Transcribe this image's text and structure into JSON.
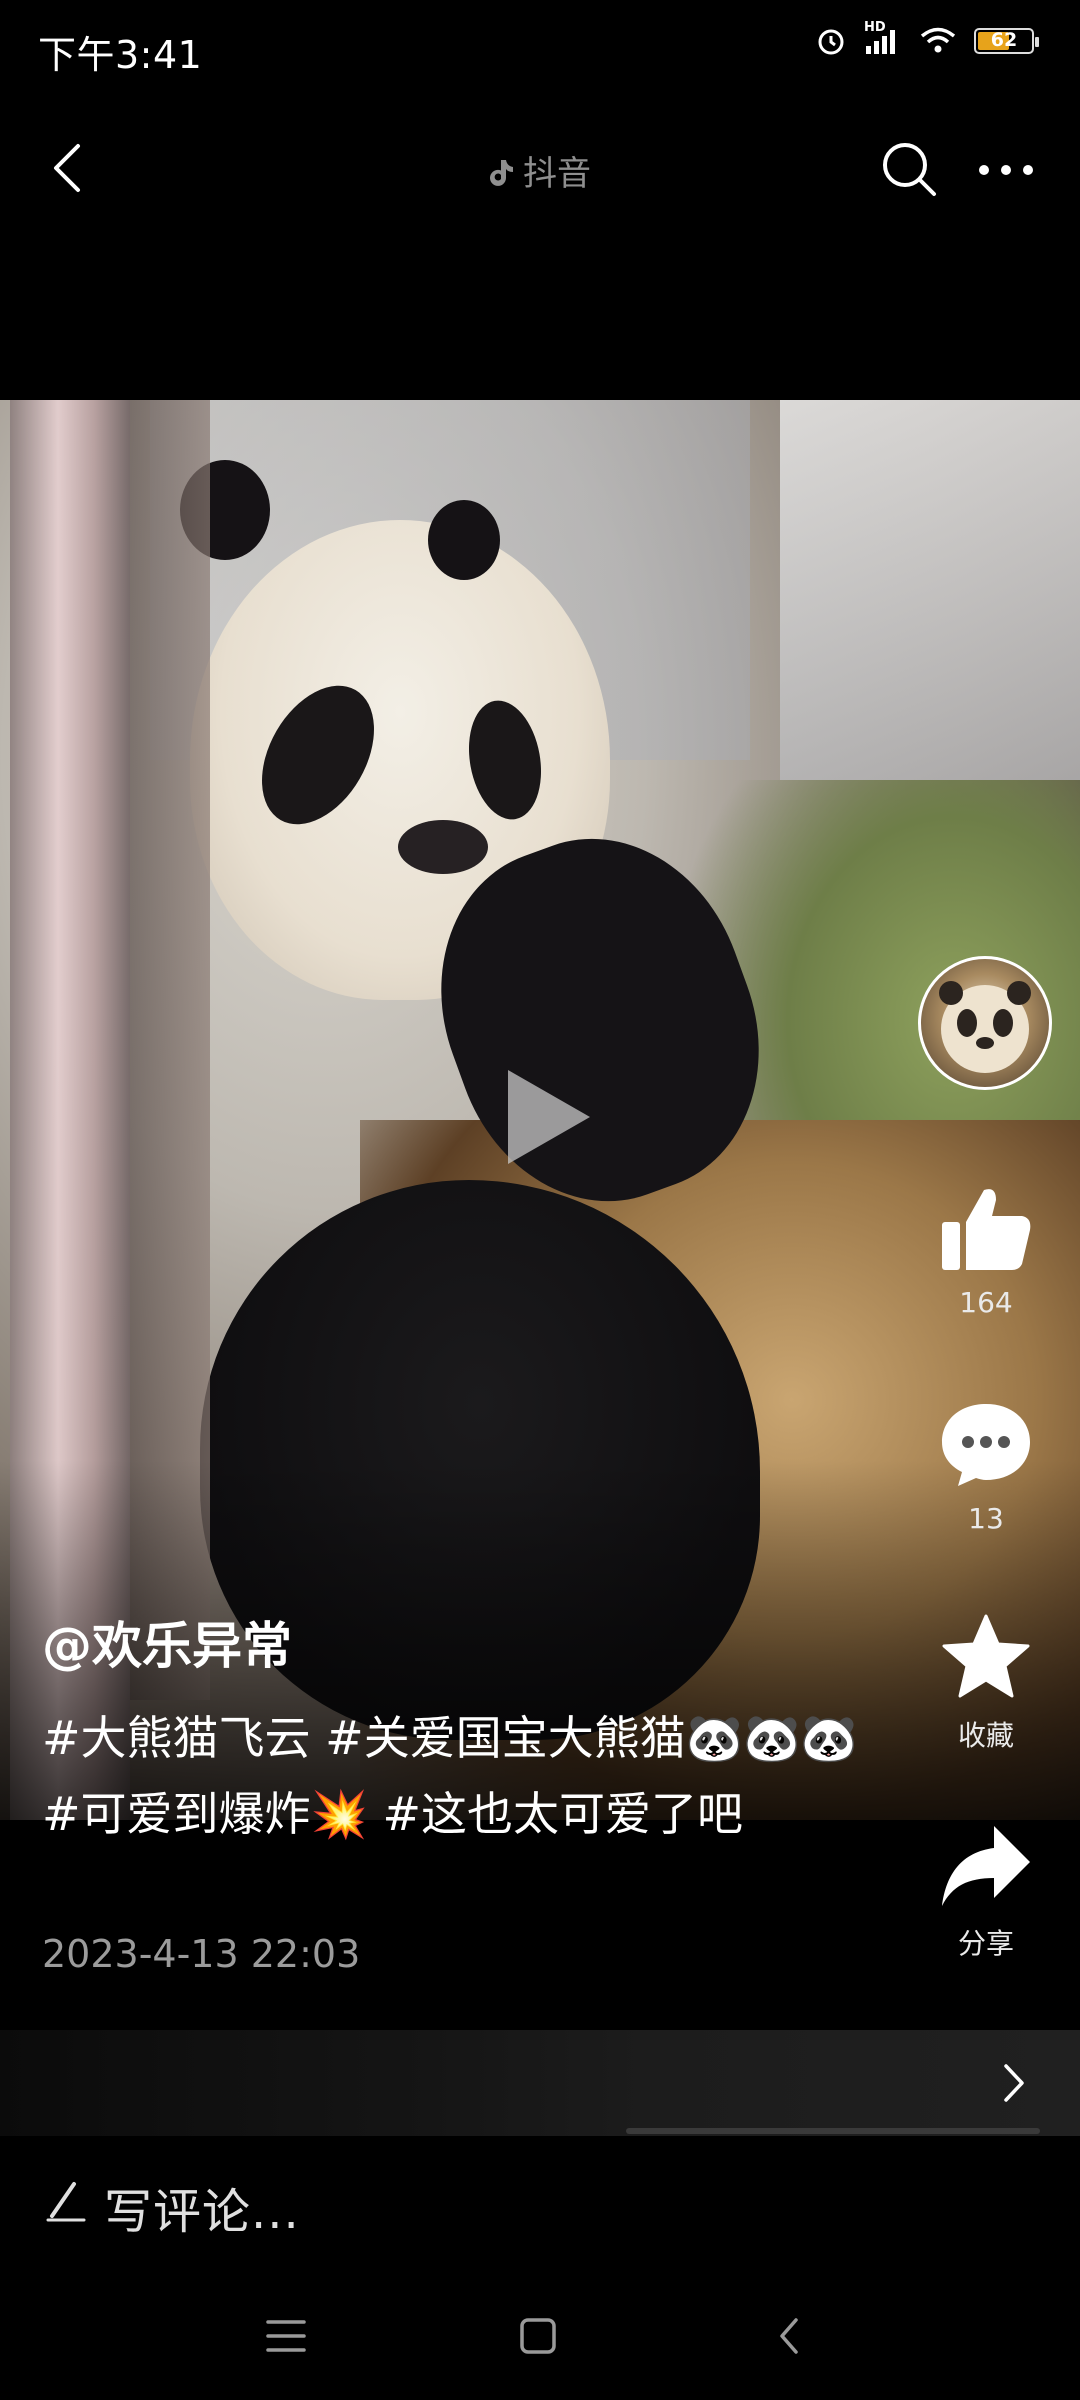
{
  "status_bar": {
    "time": "下午3:41",
    "network_label": "HD",
    "battery_level": "62",
    "battery_percent": 62,
    "icons": [
      "alarm-icon",
      "signal-icon",
      "wifi-icon",
      "battery-icon"
    ]
  },
  "top_nav": {
    "title": "抖音",
    "icons": [
      "back-icon",
      "tiktok-note-icon",
      "search-icon",
      "more-icon"
    ]
  },
  "video": {
    "state": "paused",
    "icon": "play-icon"
  },
  "actions": {
    "like_count": "164",
    "comment_count": "13",
    "favorite_label": "收藏",
    "share_label": "分享",
    "icons": [
      "avatar",
      "thumbs-up-icon",
      "comment-bubble-icon",
      "star-icon",
      "share-arrow-icon"
    ]
  },
  "post": {
    "username": "@欢乐异常",
    "caption": "#大熊猫飞云 #关爱国宝大熊猫🐼🐼🐼 #可爱到爆炸💥 #这也太可爱了吧",
    "date": "2023-4-13 22:03"
  },
  "banner": {
    "icon": "chevron-right-icon"
  },
  "comment_bar": {
    "placeholder": "写评论..."
  },
  "system_nav": {
    "icons": [
      "menu-icon",
      "home-square-icon",
      "back-triangle-icon"
    ]
  },
  "colors": {
    "background": "#000000",
    "battery_fill": "#e7a31b",
    "secondary_text": "#9b9b9b"
  }
}
